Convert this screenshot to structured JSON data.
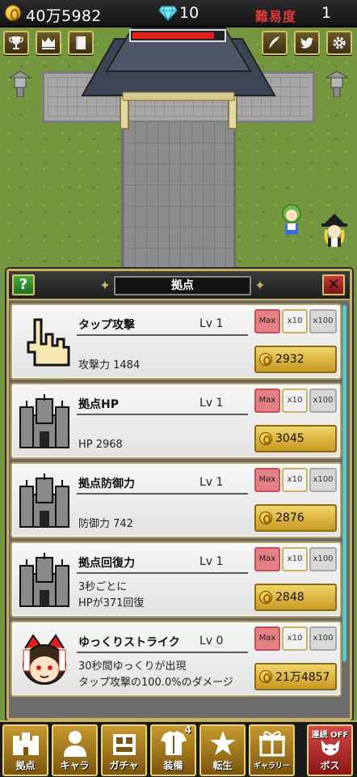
{
  "hud": {
    "gold": "40万5982",
    "gems": "10",
    "difficulty_label": "難易度",
    "difficulty_value": "1",
    "base_hp_fraction": 0.9
  },
  "top_buttons": [
    "trophy-icon",
    "crown-icon",
    "book-icon",
    "feather-icon",
    "twitter-icon",
    "gear-icon"
  ],
  "panel": {
    "help_label": "?",
    "close_label": "✕",
    "title": "拠点"
  },
  "upgrades": [
    {
      "name": "タップ攻撃",
      "level": "Lv 1",
      "desc1": "攻撃力 1484",
      "desc2": "",
      "cost": "2932",
      "icon": "tap-hand-icon"
    },
    {
      "name": "拠点HP",
      "level": "Lv 1",
      "desc1": "HP 2968",
      "desc2": "",
      "cost": "3045",
      "icon": "castle-icon"
    },
    {
      "name": "拠点防御力",
      "level": "Lv 1",
      "desc1": "防御力 742",
      "desc2": "",
      "cost": "2876",
      "icon": "castle-icon"
    },
    {
      "name": "拠点回復力",
      "level": "Lv 1",
      "desc1": "3秒ごとに",
      "desc2": "HPが371回復",
      "cost": "2848",
      "icon": "castle-icon"
    },
    {
      "name": "ゆっくりストライク",
      "level": "Lv 0",
      "desc1": "30秒間ゆっくりが出現",
      "desc2": "タップ攻撃の100.0%のダメージ",
      "cost": "21万4857",
      "icon": "yukkuri-icon"
    }
  ],
  "multipliers": {
    "max": "Max",
    "x10": "x10",
    "x100": "x100"
  },
  "nav": {
    "base": "拠点",
    "chara": "キャラ",
    "gacha": "ガチャ",
    "equip": "装備",
    "equip_badge": "4",
    "rebirth": "転生",
    "gallery": "ギャラリー",
    "boss_toggle": "連続 OFF",
    "boss": "ボス"
  },
  "colors": {
    "accent_gold": "#c8b060",
    "danger_red": "#e33a3a",
    "buy_button": "#e6c14e"
  }
}
